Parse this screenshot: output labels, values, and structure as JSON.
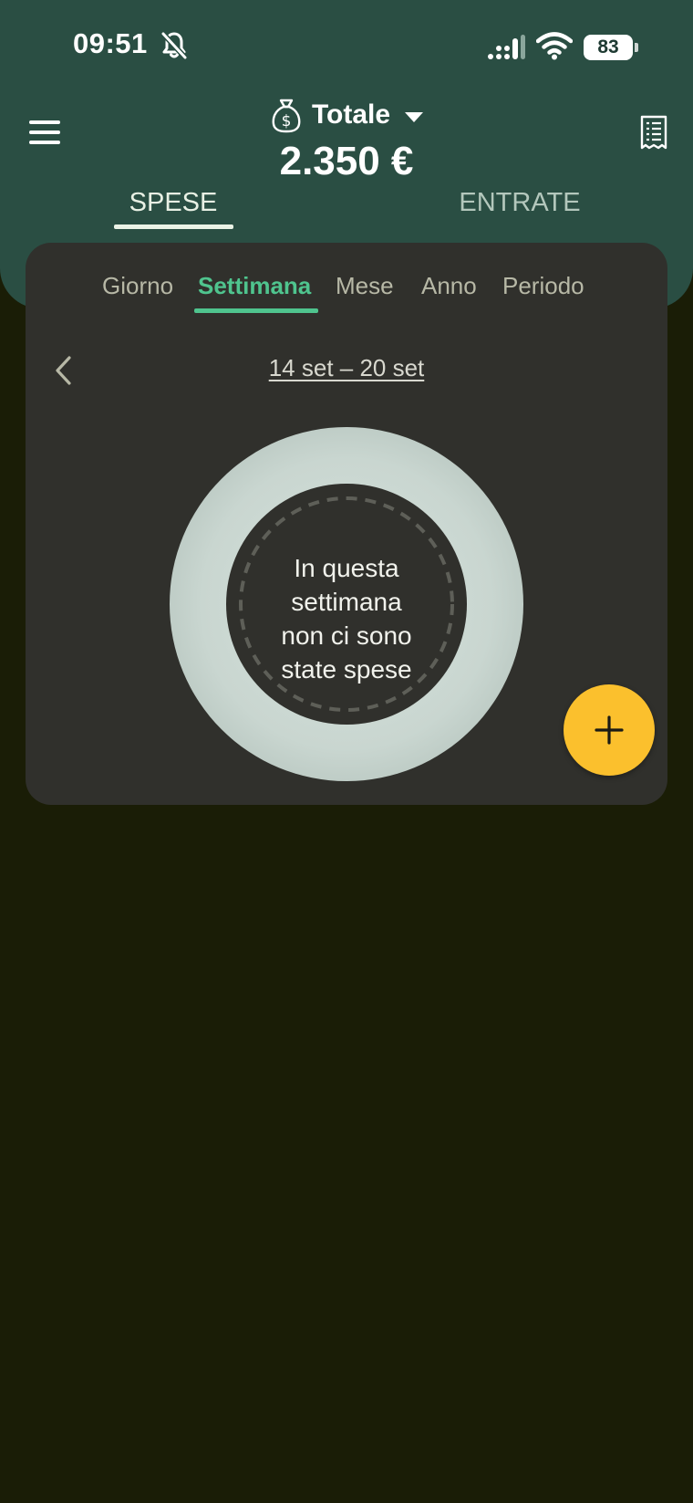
{
  "status_bar": {
    "time": "09:51",
    "battery": "83"
  },
  "header": {
    "account_name": "Totale",
    "total": "2.350 €",
    "tabs": [
      {
        "label": "SPESE",
        "active": true
      },
      {
        "label": "ENTRATE",
        "active": false
      }
    ]
  },
  "card": {
    "periods": [
      {
        "label": "Giorno",
        "active": false
      },
      {
        "label": "Settimana",
        "active": true
      },
      {
        "label": "Mese",
        "active": false
      },
      {
        "label": "Anno",
        "active": false
      },
      {
        "label": "Periodo",
        "active": false
      }
    ],
    "date_range": "14 set – 20 set",
    "empty_message_lines": [
      "In questa",
      "settimana",
      "non ci sono",
      "state spese"
    ]
  },
  "colors": {
    "header_bg": "#2a4e43",
    "page_bg": "#1a1d06",
    "card_bg": "#30302c",
    "accent": "#4fc48e",
    "fab": "#fbc02d"
  }
}
